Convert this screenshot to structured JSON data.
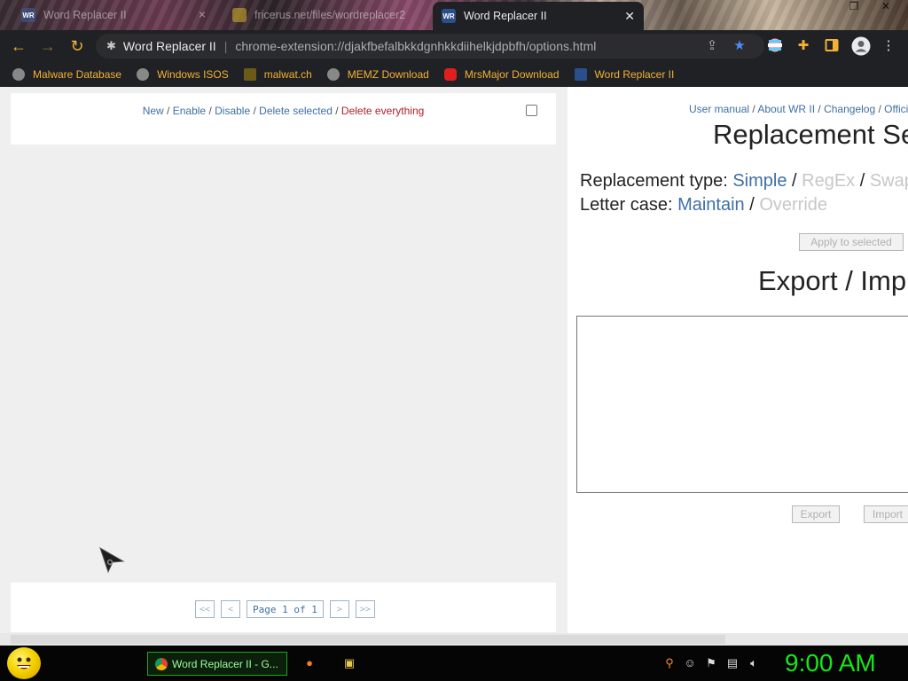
{
  "browser": {
    "tabs": [
      {
        "title": "Word Replacer II",
        "favicon": "wr-icon",
        "active": false
      },
      {
        "title": "fricerus.net/files/wordreplacer2",
        "favicon": "site-icon",
        "active": false
      },
      {
        "title": "Word Replacer II",
        "favicon": "wr-icon",
        "active": true
      }
    ],
    "omnibox": {
      "site_name": "Word Replacer II",
      "url": "chrome-extension://djakfbefalbkkdgnhkkdiihelkjdpbfh/options.html"
    },
    "bookmarks": [
      {
        "label": "Malware Database",
        "icon": "globe-icon"
      },
      {
        "label": "Windows ISOS",
        "icon": "globe-icon"
      },
      {
        "label": "malwat.ch",
        "icon": "malwatch-icon"
      },
      {
        "label": "MEMZ Download",
        "icon": "globe-icon"
      },
      {
        "label": "MrsMajor Download",
        "icon": "youtube-icon"
      },
      {
        "label": "Word Replacer II",
        "icon": "wr-icon"
      }
    ]
  },
  "left_panel": {
    "actions": {
      "new": "New",
      "enable": "Enable",
      "disable": "Disable",
      "delete_selected": "Delete selected",
      "delete_everything": "Delete everything",
      "sep": " / "
    },
    "pager": {
      "first": "<<",
      "prev": "<",
      "page_info": "Page 1 of 1",
      "next": ">",
      "last": ">>"
    }
  },
  "right_panel": {
    "links": {
      "manual": "User manual",
      "about": "About WR II",
      "changelog": "Changelog",
      "official": "Offici",
      "sep": " / "
    },
    "settings_title": "Replacement Se",
    "replacement_type": {
      "label": "Replacement type: ",
      "options": [
        "Simple",
        "RegEx",
        "Swap"
      ],
      "selected": "Simple"
    },
    "letter_case": {
      "label": "Letter case: ",
      "options": [
        "Maintain",
        "Override"
      ],
      "selected": "Maintain"
    },
    "apply_button": "Apply to selected",
    "export_title": "Export / Imp",
    "export_textarea_value": "",
    "export_button": "Export",
    "import_button": "Import"
  },
  "taskbar": {
    "start_icon": "smiley-icon",
    "task_label": "Word Replacer II - G...",
    "clock": "9:00 AM"
  },
  "colors": {
    "link": "#3d6fa6",
    "danger": "#b0202a",
    "disabled_text": "#c7c7c7",
    "browser_chrome": "#202124",
    "bookmark_text": "#f2b134",
    "clock_green": "#19e519"
  }
}
